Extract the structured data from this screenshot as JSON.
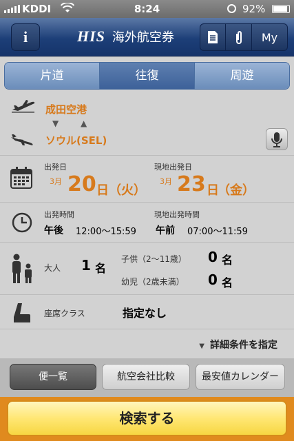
{
  "status_bar": {
    "carrier": "KDDI",
    "time": "8:24",
    "battery": "92%",
    "battery_level": 0.92
  },
  "header": {
    "info_label": "i",
    "logo": "HIS",
    "title": "海外航空券",
    "right_buttons": [
      "document-icon",
      "paperclip-icon",
      "My"
    ]
  },
  "trip_tabs": [
    {
      "label": "片道",
      "active": false
    },
    {
      "label": "往復",
      "active": true
    },
    {
      "label": "周遊",
      "active": false
    }
  ],
  "route": {
    "origin": "成田空港",
    "destination": "ソウル(SEL)",
    "swap_arrows": "▼ ▲"
  },
  "dates": {
    "depart_label": "出発日",
    "depart_month": "3月",
    "depart_day": "20",
    "depart_unit": "日",
    "depart_weekday": "（火）",
    "local_label": "現地出発日",
    "local_month": "3月",
    "local_day": "23",
    "local_unit": "日",
    "local_weekday": "（金）"
  },
  "times": {
    "depart_label": "出発時間",
    "depart_period": "午後",
    "depart_range": "12:00〜15:59",
    "local_label": "現地出発時間",
    "local_period": "午前",
    "local_range": "07:00〜11:59"
  },
  "passengers": {
    "adult_label": "大人",
    "adult_count": "1",
    "adult_unit": "名",
    "child_label": "子供（2〜11歳）",
    "child_count": "0",
    "child_unit": "名",
    "infant_label": "幼児（2歳未満）",
    "infant_count": "0",
    "infant_unit": "名"
  },
  "seat": {
    "label": "座席クラス",
    "value": "指定なし"
  },
  "details_link": "詳細条件を指定",
  "bottom_tabs": [
    {
      "label": "便一覧",
      "active": true
    },
    {
      "label": "航空会社比較",
      "active": false
    },
    {
      "label": "最安値カレンダー",
      "active": false
    }
  ],
  "search_button": "検索する",
  "colors": {
    "accent": "#d77a1c",
    "header": "#1d3f78",
    "search_border": "#e08a1e"
  }
}
